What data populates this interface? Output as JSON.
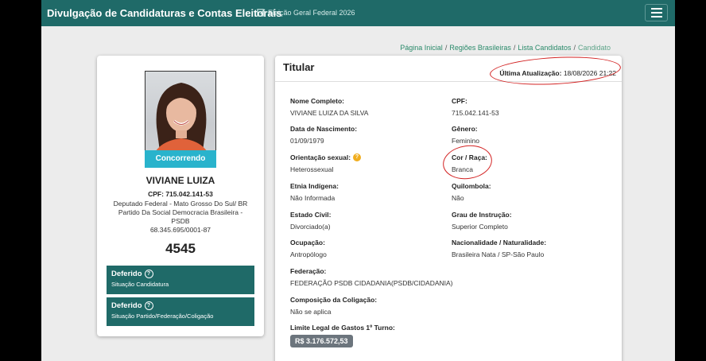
{
  "header": {
    "title": "Divulgação de Candidaturas e Contas Eleitorais",
    "election": "Eleição Geral Federal 2026",
    "icons": {
      "edit": "edit-icon",
      "menu": "hamburger-menu-icon"
    }
  },
  "breadcrumb": {
    "items": [
      "Página Inicial",
      "Regiões Brasileiras",
      "Lista Candidatos"
    ],
    "current": "Candidato"
  },
  "candidate": {
    "status_tag": "Concorrendo",
    "name": "VIVIANE LUIZA",
    "cpf": "CPF: 715.042.141-53",
    "office_lines": [
      "Deputado Federal - Mato Grosso Do Sul/ BR",
      "Partido Da Social Democracia Brasileira -",
      "PSDB",
      "68.345.695/0001-87"
    ],
    "number": "4545",
    "situations": [
      {
        "title": "Deferido",
        "subtitle": "Situação Candidatura"
      },
      {
        "title": "Deferido",
        "subtitle": "Situação Partido/Federação/Coligação"
      }
    ]
  },
  "details": {
    "title": "Titular",
    "last_update_label": "Última Atualização:",
    "last_update_value": "18/08/2026 21:22",
    "fields": {
      "nome": {
        "label": "Nome Completo:",
        "value": "VIVIANE LUIZA DA SILVA"
      },
      "cpf": {
        "label": "CPF:",
        "value": "715.042.141-53"
      },
      "nascimento": {
        "label": "Data de Nascimento:",
        "value": "01/09/1979"
      },
      "genero": {
        "label": "Gênero:",
        "value": "Feminino"
      },
      "orientacao": {
        "label": "Orientação sexual:",
        "value": "Heterossexual"
      },
      "cor": {
        "label": "Cor / Raça:",
        "value": "Branca"
      },
      "etnia": {
        "label": "Etnia Indígena:",
        "value": "Não Informada"
      },
      "quilombola": {
        "label": "Quilombola:",
        "value": "Não"
      },
      "estado_civil": {
        "label": "Estado Civil:",
        "value": "Divorciado(a)"
      },
      "instrucao": {
        "label": "Grau de Instrução:",
        "value": "Superior Completo"
      },
      "ocupacao": {
        "label": "Ocupação:",
        "value": "Antropólogo"
      },
      "nacionalidade": {
        "label": "Nacionalidade / Naturalidade:",
        "value": "Brasileira Nata / SP-São Paulo"
      },
      "federacao": {
        "label": "Federação:",
        "value": "FEDERAÇÃO PSDB CIDADANIA(PSDB/CIDADANIA)"
      },
      "coligacao": {
        "label": "Composição da Coligação:",
        "value": "Não se aplica"
      },
      "limite": {
        "label": "Limite Legal de Gastos 1º Turno:",
        "value": "R$ 3.176.572,53"
      }
    }
  },
  "colors": {
    "primary": "#1f6a68",
    "status_tag": "#29b3cc",
    "annotation": "#d32323",
    "warning": "#f0ad1e"
  }
}
